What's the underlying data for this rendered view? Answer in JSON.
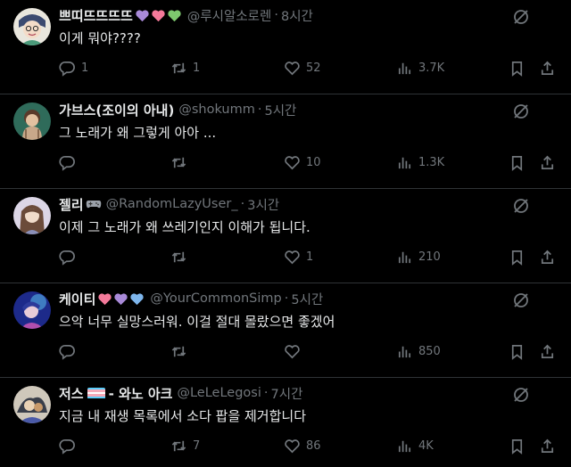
{
  "tweets": [
    {
      "name": "쁘띠뜨뜨뜨뜨",
      "handle": "@루시알소로렌",
      "time": "8시간",
      "text": "이게 뭐야????",
      "replies": "1",
      "retweets": "1",
      "likes": "52",
      "views": "3.7K",
      "name_emojis": [
        "purple-heart",
        "pink-heart",
        "green-heart"
      ],
      "avatar_colors": [
        "#dcd9cf",
        "#4a5a7a"
      ]
    },
    {
      "name": "가브스(조이의 아내)",
      "handle": "@shokumm",
      "time": "5시간",
      "text": "그 노래가 왜 그렇게 아아 ...",
      "replies": "",
      "retweets": "",
      "likes": "10",
      "views": "1.3K",
      "name_emojis": [],
      "avatar_colors": [
        "#2f6b5a",
        "#c9a88a"
      ]
    },
    {
      "name": "젤리",
      "handle": "@RandomLazyUser_",
      "time": "3시간",
      "text": "이제 그 노래가 왜 쓰레기인지 이해가 됩니다.",
      "replies": "",
      "retweets": "",
      "likes": "1",
      "views": "210",
      "name_emojis": [
        "game-controller"
      ],
      "avatar_colors": [
        "#d8d3e3",
        "#6b4b3a"
      ]
    },
    {
      "name": "케이티",
      "handle": "@YourCommonSimp",
      "time": "5시간",
      "text": "으악 너무 실망스러워. 이걸 절대 몰랐으면 좋겠어",
      "replies": "",
      "retweets": "",
      "likes": "",
      "views": "850",
      "name_emojis": [
        "pink-heart",
        "purple-heart",
        "blue-heart"
      ],
      "avatar_colors": [
        "#1d2a8a",
        "#4fa0d8"
      ]
    },
    {
      "name": "저스",
      "name_suffix": "- 와노 아크",
      "handle": "@LeLeLegosi",
      "time": "7시간",
      "text": "지금 내 재생 목록에서 소다 팝을 제거합니다",
      "replies": "",
      "retweets": "7",
      "likes": "86",
      "views": "4K",
      "name_emojis": [
        "transgender-flag"
      ],
      "avatar_colors": [
        "#c9c3b8",
        "#3a3f4a"
      ]
    }
  ],
  "colors": {
    "background": "#000000",
    "text": "#e7e9ea",
    "muted": "#71767b",
    "divider": "#2f3336",
    "purple-heart": "#a98ad8",
    "pink-heart": "#f47a9a",
    "green-heart": "#7ec86e",
    "blue-heart": "#7eb6ec"
  }
}
